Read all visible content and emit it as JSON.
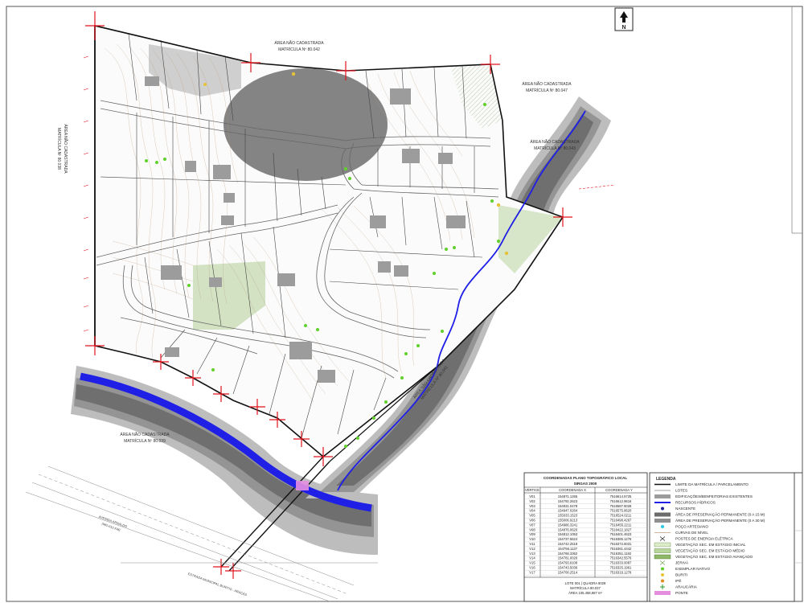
{
  "north": {
    "label": "N"
  },
  "areas": {
    "top": {
      "line1": "ÁREA NÃO CADASTRADA",
      "line2": "MATRÍCULA Nº 80.042"
    },
    "right_top": {
      "line1": "ÁREA NÃO CADASTRADA",
      "line2": "MATRÍCULA Nº 80.047"
    },
    "right_mid": {
      "line1": "ÁREA NÃO CADASTRADA",
      "line2": "MATRÍCULA Nº 80.043"
    },
    "left": {
      "line1": "ÁREA NÃO CADASTRADA",
      "line2": "MATRÍCULA Nº 80.038"
    },
    "bottom": {
      "line1": "ÁREA NÃO CADASTRADA",
      "line2": "MATRÍCULA Nº 80.039"
    },
    "stream": {
      "line1": "ÁREA NÃO CADASTRADA",
      "line2": "MATRÍCULA Nº 80.041"
    }
  },
  "roads": {
    "avenue": {
      "line1": "AVENIDA ARNALDO",
      "line2": "(MG-010 KM)"
    },
    "street": {
      "line1": "ESTRADA MUNICIPAL BURITIS - ARAÇÁS"
    }
  },
  "coord_table": {
    "title_line1": "COORDENADAS PLANO TOPOGRÁFICO LOCAL",
    "title_line2": "SIRGAS 2000",
    "headers": [
      "VÉRTICE",
      "COORDENADA X",
      "COORDENADA Y"
    ],
    "rows": [
      [
        "V01",
        "154871.1265",
        "7516614.5725"
      ],
      [
        "V02",
        "154792.2623",
        "7516612.9616"
      ],
      [
        "V03",
        "154931.0478",
        "7516587.6028"
      ],
      [
        "V04",
        "154947.0264",
        "7516575.8620"
      ],
      [
        "V05",
        "155033.1523",
        "7516524.0211"
      ],
      [
        "V06",
        "155006.9213",
        "7516498.4267"
      ],
      [
        "V07",
        "154986.3241",
        "7516455.2211"
      ],
      [
        "V08",
        "154876.0620",
        "7516422.1827"
      ],
      [
        "V09",
        "154812.1053",
        "7516401.4623"
      ],
      [
        "V10",
        "154737.6624",
        "7516385.1276"
      ],
      [
        "V11",
        "154742.2518",
        "7516372.6031"
      ],
      [
        "V12",
        "154756.1137",
        "7516361.4442"
      ],
      [
        "V13",
        "154768.3362",
        "7516351.1192"
      ],
      [
        "V14",
        "154781.0026",
        "7516342.5576"
      ],
      [
        "V15",
        "154793.6108",
        "7516333.0087"
      ],
      [
        "V16",
        "154743.5036",
        "7516325.1961"
      ],
      [
        "V17",
        "154700.2514",
        "7516319.1278"
      ]
    ],
    "footer_line1": "LOTE 001 | QUADRA 8028",
    "footer_line2": "MATRÍCULA 80.037",
    "footer_line3": "ÁREA 105.458,987 m²"
  },
  "legend": {
    "title": "LEGENDA",
    "items": [
      {
        "label": "LIMITE DA MATRÍCULA / PARCELAMENTO",
        "symbol": "thick-line"
      },
      {
        "label": "LOTES",
        "symbol": "thin-line"
      },
      {
        "label": "EDIFICAÇÕES/BENFEITORIAS EXISTENTES",
        "symbol": "grey-box"
      },
      {
        "label": "RECURSOS HÍDRICOS",
        "symbol": "blue-line"
      },
      {
        "label": "NASCENTE",
        "symbol": "blue-dot"
      },
      {
        "label": "ÁREA DE PRESERVAÇÃO PERMANENTE (0 A 15 M)",
        "symbol": "dark-box"
      },
      {
        "label": "ÁREA DE PRESERVAÇÃO PERMANENTE (0 A 30 M)",
        "symbol": "mid-box"
      },
      {
        "label": "POÇO ARTESIANO",
        "symbol": "cyan-dot"
      },
      {
        "label": "CURVAS DE NÍVEL",
        "symbol": "brown-line"
      },
      {
        "label": "POSTES DE ENERGIA ELÉTRICA",
        "symbol": "x-mark"
      },
      {
        "label": "VEGETAÇÃO SEC. EM ESTÁGIO INICIAL",
        "symbol": "light-green-box"
      },
      {
        "label": "VEGETAÇÃO SEC. EM ESTÁGIO MÉDIO",
        "symbol": "green-box"
      },
      {
        "label": "VEGETAÇÃO SEC. EM ESTÁGIO AVANÇADO",
        "symbol": "dark-green-box"
      },
      {
        "label": "JERIVÁ",
        "symbol": "palm"
      },
      {
        "label": "EXEMPLAR NATIVO",
        "symbol": "green-dot"
      },
      {
        "label": "BURITI",
        "symbol": "yellow-dot"
      },
      {
        "label": "IPÊ",
        "symbol": "orange-dot"
      },
      {
        "label": "ARAUCÁRIA",
        "symbol": "cross"
      },
      {
        "label": "PONTE",
        "symbol": "pink-box"
      }
    ]
  },
  "vertices": [
    "V01",
    "V02",
    "V03",
    "V04",
    "V05",
    "V06",
    "V07",
    "V08",
    "V09",
    "V10",
    "V11",
    "V12",
    "V13",
    "V14",
    "V15",
    "V16",
    "V17"
  ],
  "colors": {
    "app_light": "#b9b9b9",
    "app_mid": "#8f8f8f",
    "app_dark": "#6b6b6b",
    "water": "#1f1fe6",
    "veg": "#c8dcb4",
    "boundary": "#111111",
    "vertex": "#e0141e"
  }
}
